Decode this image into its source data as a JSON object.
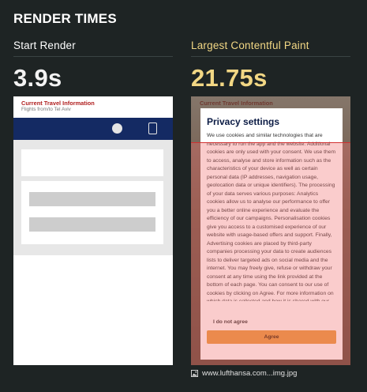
{
  "heading": "RENDER TIMES",
  "metrics": [
    {
      "label": "Start Render",
      "value": "3.9s"
    },
    {
      "label": "Largest Contentful Paint",
      "value": "21.75s"
    }
  ],
  "left_shot": {
    "title": "Current Travel Information",
    "subtitle": "Flights from/to Tel Aviv"
  },
  "right_shot": {
    "title": "Current Travel Information",
    "modal_title": "Privacy settings",
    "modal_text": "We use cookies and similar technologies that are necessary to run the app and the website. Additional cookies are only used with your consent. We use them to access, analyse and store information such as the characteristics of your device as well as certain personal data (IP addresses, navigation usage, geolocation data or unique identifiers). The processing of your data serves various purposes: Analytics cookies allow us to analyse our performance to offer you a better online experience and evaluate the efficiency of our campaigns. Personalisation cookies give you access to a customised experience of our website with usage-based offers and support. Finally, Advertising cookies are placed by third-party companies processing your data to create audiences lists to deliver targeted ads on social media and the internet. You may freely give, refuse or withdraw your consent at any time using the link provided at the bottom of each page. You can consent to our use of cookies by clicking on Agree. For more information on which data is collected and how it is shared with our partners please read our privacy and cookie policy: → Privacy Policy  → Cookie Policy",
    "reject_label": "I do not agree",
    "accept_label": "Agree"
  },
  "caption": {
    "icon": "image-icon",
    "text": "www.lufthansa.com...img.jpg"
  },
  "colors": {
    "background": "#1e2424",
    "accent": "#f2d784",
    "highlight": "#d23030",
    "nav": "#142a63"
  }
}
